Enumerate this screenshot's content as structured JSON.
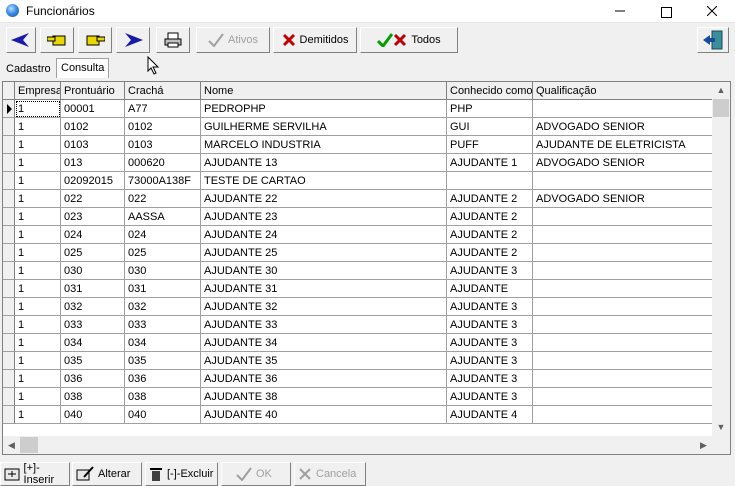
{
  "window": {
    "title": "Funcionários"
  },
  "toolbar": {
    "ativos_label": "Ativos",
    "demitidos_label": "Demitidos",
    "todos_label": "Todos"
  },
  "tabs": [
    {
      "label": "Cadastro"
    },
    {
      "label": "Consulta"
    }
  ],
  "grid": {
    "columns": [
      "Empresa",
      "Prontuário",
      "Crachá",
      "Nome",
      "Conhecido como",
      "Qualificação"
    ],
    "rows": [
      [
        "1",
        "00001",
        "A77",
        "PEDROPHP",
        "PHP",
        ""
      ],
      [
        "1",
        "0102",
        "0102",
        "GUILHERME SERVILHA",
        "GUI",
        "ADVOGADO SENIOR"
      ],
      [
        "1",
        "0103",
        "0103",
        "MARCELO INDUSTRIA",
        "PUFF",
        "AJUDANTE DE ELETRICISTA"
      ],
      [
        "1",
        "013",
        "000620",
        "AJUDANTE 13",
        "AJUDANTE 1",
        "ADVOGADO SENIOR"
      ],
      [
        "1",
        "02092015",
        "73000A138F",
        "TESTE DE CARTAO",
        "",
        ""
      ],
      [
        "1",
        "022",
        "022",
        "AJUDANTE 22",
        "AJUDANTE 2",
        "ADVOGADO SENIOR"
      ],
      [
        "1",
        "023",
        "AASSA",
        "AJUDANTE 23",
        "AJUDANTE 2",
        ""
      ],
      [
        "1",
        "024",
        "024",
        "AJUDANTE 24",
        "AJUDANTE 2",
        ""
      ],
      [
        "1",
        "025",
        "025",
        "AJUDANTE 25",
        "AJUDANTE 2",
        ""
      ],
      [
        "1",
        "030",
        "030",
        "AJUDANTE 30",
        "AJUDANTE 3",
        ""
      ],
      [
        "1",
        "031",
        "031",
        "AJUDANTE 31",
        "AJUDANTE",
        ""
      ],
      [
        "1",
        "032",
        "032",
        "AJUDANTE 32",
        "AJUDANTE 3",
        ""
      ],
      [
        "1",
        "033",
        "033",
        "AJUDANTE 33",
        "AJUDANTE 3",
        ""
      ],
      [
        "1",
        "034",
        "034",
        "AJUDANTE 34",
        "AJUDANTE 3",
        ""
      ],
      [
        "1",
        "035",
        "035",
        "AJUDANTE 35",
        "AJUDANTE 3",
        ""
      ],
      [
        "1",
        "036",
        "036",
        "AJUDANTE 36",
        "AJUDANTE 3",
        ""
      ],
      [
        "1",
        "038",
        "038",
        "AJUDANTE 38",
        "AJUDANTE 3",
        ""
      ],
      [
        "1",
        "040",
        "040",
        "AJUDANTE 40",
        "AJUDANTE 4",
        ""
      ]
    ]
  },
  "bottom": {
    "inserir_label": "[+]-Inserir",
    "alterar_label": "Alterar",
    "excluir_label": "[-]-Excluir",
    "ok_label": "OK",
    "cancela_label": "Cancela"
  },
  "colors": {
    "accent_blue": "#1a1aa8",
    "delete_red": "#c00000",
    "ok_green": "#00a000"
  }
}
